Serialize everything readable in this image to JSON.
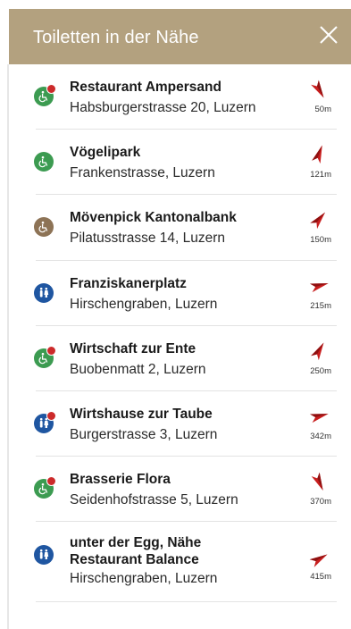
{
  "header": {
    "title": "Toiletten in der Nähe"
  },
  "items": [
    {
      "name": "Restaurant Ampersand",
      "address": "Habsburgerstrasse 20, Luzern",
      "distance": "50m",
      "icon": "wheelchair-icon",
      "color": "#3c9b51",
      "badge": true,
      "bearing": 150
    },
    {
      "name": "Vögelipark",
      "address": "Frankenstrasse, Luzern",
      "distance": "121m",
      "icon": "wheelchair-icon",
      "color": "#3c9b51",
      "badge": false,
      "bearing": 20
    },
    {
      "name": "Mövenpick Kantonalbank",
      "address": "Pilatusstrasse 14, Luzern",
      "distance": "150m",
      "icon": "wheelchair-icon",
      "color": "#8d7356",
      "badge": false,
      "bearing": 40
    },
    {
      "name": "Franziskanerplatz",
      "address": "Hirschengraben, Luzern",
      "distance": "215m",
      "icon": "toilet-people-icon",
      "color": "#1f56a1",
      "badge": false,
      "bearing": 75
    },
    {
      "name": "Wirtschaft zur Ente",
      "address": "Buobenmatt 2, Luzern",
      "distance": "250m",
      "icon": "wheelchair-icon",
      "color": "#3c9b51",
      "badge": true,
      "bearing": 30
    },
    {
      "name": "Wirtshause zur Taube",
      "address": "Burgerstrasse 3, Luzern",
      "distance": "342m",
      "icon": "toilet-people-icon",
      "color": "#1f56a1",
      "badge": true,
      "bearing": 75
    },
    {
      "name": "Brasserie Flora",
      "address": "Seidenhofstrasse 5, Luzern",
      "distance": "370m",
      "icon": "wheelchair-icon",
      "color": "#3c9b51",
      "badge": true,
      "bearing": 155
    },
    {
      "name": "unter der Egg, Nähe Restaurant Balance",
      "address": "Hirschengraben, Luzern",
      "distance": "415m",
      "icon": "toilet-people-icon",
      "color": "#1f56a1",
      "badge": false,
      "bearing": 60
    }
  ]
}
